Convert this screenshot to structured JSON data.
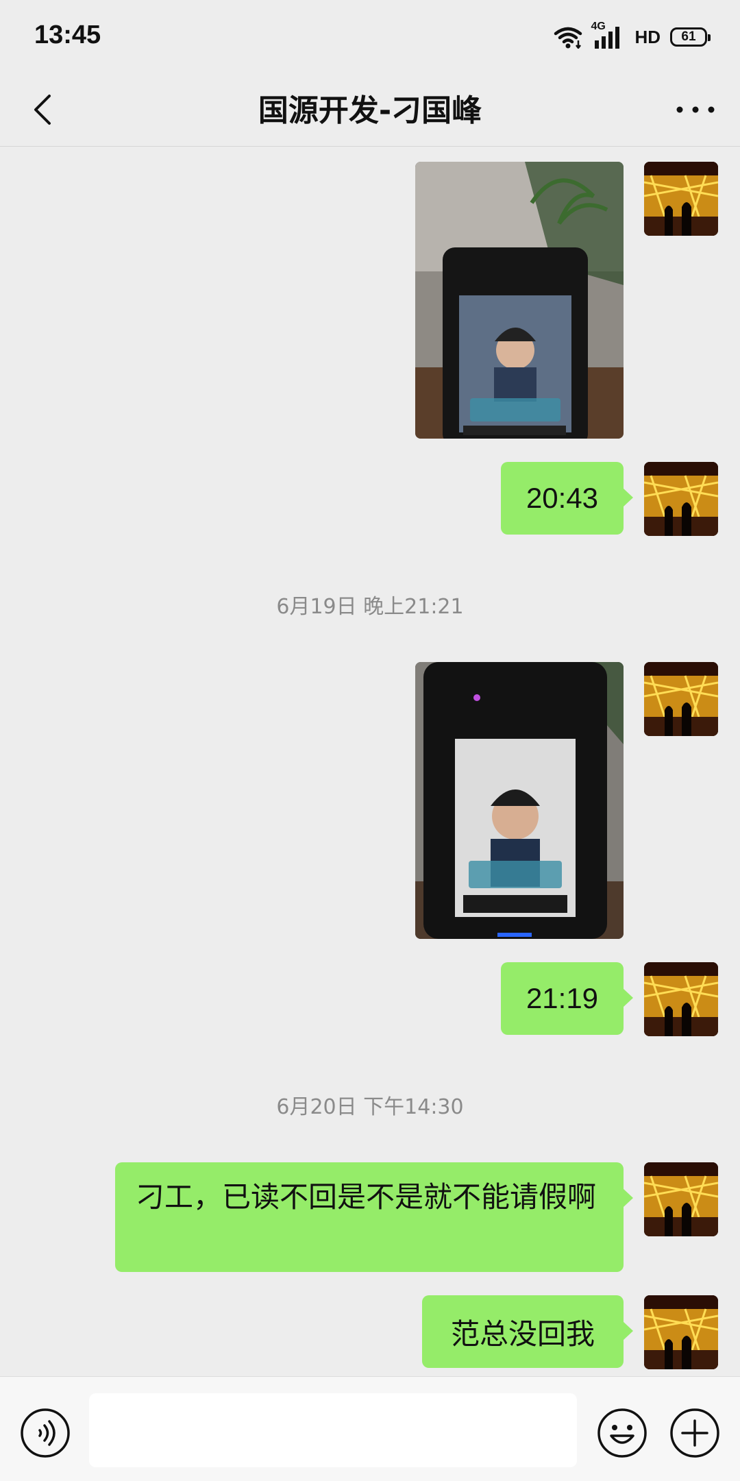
{
  "status_bar": {
    "time": "13:45",
    "network": "4G",
    "hd": "HD",
    "battery": "61"
  },
  "header": {
    "title": "国源开发-刁国峰",
    "back_icon": "chevron-left-icon",
    "more_icon": "more-horizontal-icon"
  },
  "messages": [
    {
      "type": "image",
      "sender": "me",
      "description_icon": "photo-face-terminal"
    },
    {
      "type": "text",
      "sender": "me",
      "text": "20:43"
    },
    {
      "type": "timestamp",
      "text": "6月19日 晚上21:21"
    },
    {
      "type": "image",
      "sender": "me",
      "description_icon": "photo-face-terminal"
    },
    {
      "type": "text",
      "sender": "me",
      "text": "21:19"
    },
    {
      "type": "timestamp",
      "text": "6月20日 下午14:30"
    },
    {
      "type": "text",
      "sender": "me",
      "text": "刁工，已读不回是不是就不能请假啊"
    },
    {
      "type": "text",
      "sender": "me",
      "text": "范总没回我"
    }
  ],
  "input_bar": {
    "voice_icon": "voice-icon",
    "message_placeholder": "",
    "emoji_icon": "emoji-icon",
    "plus_icon": "plus-icon"
  },
  "colors": {
    "background": "#ededed",
    "bubble": "#95ec69",
    "timestamp_text": "#8a8a8a"
  }
}
